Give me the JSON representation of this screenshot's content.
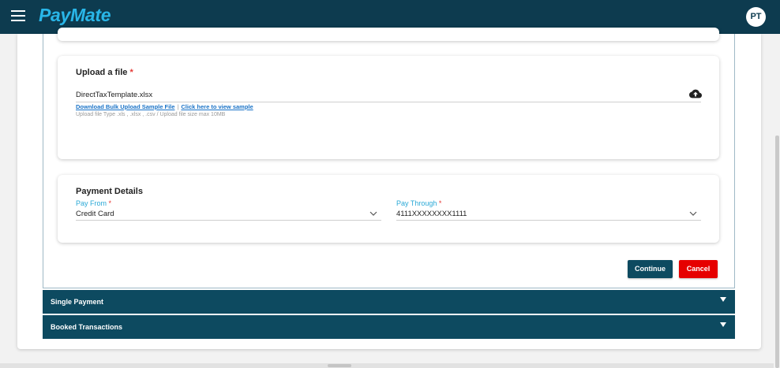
{
  "app": {
    "brand": "PayMate",
    "user_initials": "PT"
  },
  "upload": {
    "title": "Upload a file",
    "required_mark": "*",
    "file_name": "DirectTaxTemplate.xlsx",
    "download_link": "Download Bulk Upload Sample File",
    "separator": "|",
    "view_sample_link": "Click here to view sample",
    "hint": "Upload file Type .xls , .xlsx , .csv / Upload file size max 10MB"
  },
  "payment": {
    "title": "Payment Details",
    "pay_from": {
      "label": "Pay From",
      "required_mark": "*",
      "value": "Credit Card"
    },
    "pay_through": {
      "label": "Pay Through",
      "required_mark": "*",
      "value": "4111XXXXXXXX1111"
    }
  },
  "actions": {
    "continue_label": "Continue",
    "cancel_label": "Cancel"
  },
  "accordions": {
    "single_payment": "Single Payment",
    "booked_transactions": "Booked Transactions"
  },
  "colors": {
    "header_bg": "#0d3b4f",
    "brand": "#29b6e8",
    "primary": "#0d4a60",
    "danger": "#e60000",
    "field_label": "#29a8d6",
    "link": "#1a73c7"
  },
  "icons": {
    "menu": "hamburger-menu-icon",
    "upload": "cloud-upload-icon",
    "dropdown": "chevron-down-icon",
    "accordion": "caret-down-icon"
  }
}
